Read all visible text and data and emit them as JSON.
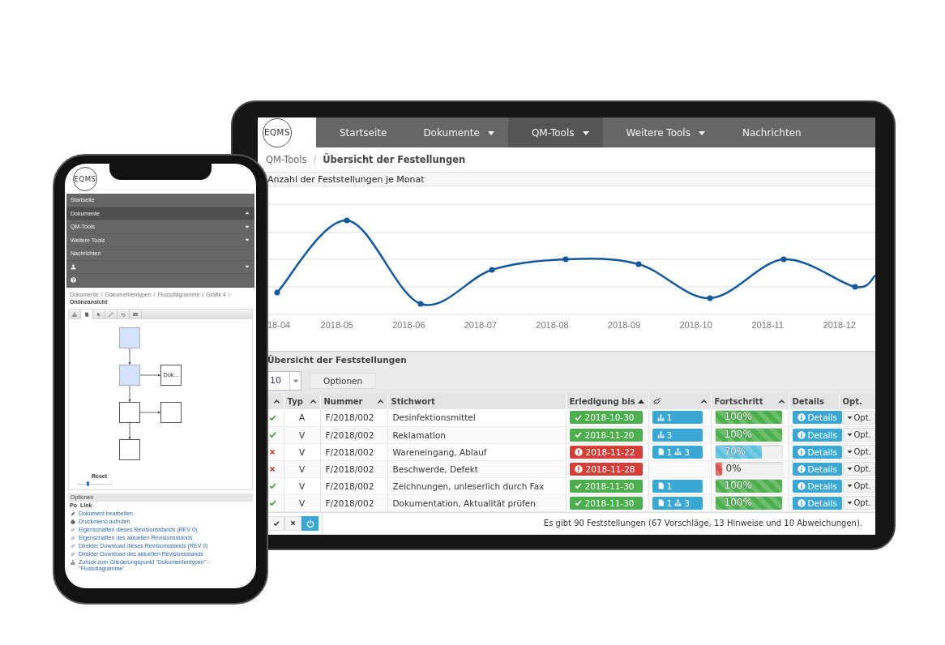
{
  "tablet": {
    "logo": "EQMS",
    "nav": [
      {
        "label": "Startseite",
        "dropdown": false,
        "selected": false
      },
      {
        "label": "Dokumente",
        "dropdown": true,
        "selected": false
      },
      {
        "label": "QM-Tools",
        "dropdown": true,
        "selected": true
      },
      {
        "label": "Weitere Tools",
        "dropdown": true,
        "selected": false
      },
      {
        "label": "Nachrichten",
        "dropdown": false,
        "selected": false
      }
    ],
    "breadcrumb": {
      "separator": "/",
      "items": [
        "QM-Tools",
        "Übersicht der Festellungen"
      ]
    },
    "chart": {
      "title": "Anzahl der Feststellungen je Monat",
      "x_labels": [
        "18-04",
        "2018-05",
        "2018-06",
        "2018-07",
        "2018-08",
        "2018-09",
        "2018-10",
        "2018-11",
        "2018-12"
      ]
    },
    "findings": {
      "title": "Übersicht der Feststellungen",
      "page_size": "10",
      "options_button": "Optionen",
      "columns": [
        {
          "kind": "blank",
          "sortable": true,
          "sorted": false
        },
        {
          "kind": "text",
          "label": "Typ",
          "sortable": true,
          "sorted": false
        },
        {
          "kind": "text",
          "label": "Nummer",
          "sortable": true,
          "sorted": false
        },
        {
          "kind": "text",
          "label": "Stichwort",
          "sortable": false
        },
        {
          "kind": "text",
          "label": "Erledigung bis",
          "sortable": true,
          "sorted": true
        },
        {
          "kind": "link",
          "sortable": true,
          "sorted": false
        },
        {
          "kind": "text",
          "label": "Fortschritt",
          "sortable": true,
          "sorted": false
        },
        {
          "kind": "text",
          "label": "Details",
          "sortable": false
        },
        {
          "kind": "text",
          "label": "Opt.",
          "sortable": false
        }
      ],
      "rows": [
        {
          "done": true,
          "typ": "A",
          "nummer": "F/2018/002",
          "stichwort": "Desinfektionsmittel",
          "due": {
            "overdue": false,
            "date": "2018-10-30"
          },
          "links": [
            {
              "kind": "tree",
              "count": "1"
            }
          ],
          "progress": {
            "level": 1,
            "text": "100%"
          },
          "details": "Details",
          "opt": "Opt."
        },
        {
          "done": true,
          "typ": "V",
          "nummer": "F/2018/002",
          "stichwort": "Reklamation",
          "due": {
            "overdue": false,
            "date": "2018-11-20"
          },
          "links": [
            {
              "kind": "tree",
              "count": "3"
            }
          ],
          "progress": {
            "level": 1,
            "text": "100%"
          },
          "details": "Details",
          "opt": "Opt."
        },
        {
          "done": false,
          "typ": "V",
          "nummer": "F/2018/002",
          "stichwort": "Wareneingang, Ablauf",
          "due": {
            "overdue": true,
            "date": "2018-11-22"
          },
          "links": [
            {
              "kind": "doc",
              "count": "1"
            },
            {
              "kind": "tree",
              "count": "3"
            }
          ],
          "progress": {
            "level": 0.7,
            "text": "70%"
          },
          "details": "Details",
          "opt": "Opt."
        },
        {
          "done": false,
          "typ": "V",
          "nummer": "F/2018/002",
          "stichwort": "Beschwerde, Defekt",
          "due": {
            "overdue": true,
            "date": "2018-11-28"
          },
          "progress": {
            "level": 0,
            "text": "0%"
          },
          "details": "Details",
          "opt": "Opt."
        },
        {
          "done": true,
          "typ": "V",
          "nummer": "F/2018/002",
          "stichwort": "Zeichnungen, unleserlich durch Fax",
          "due": {
            "overdue": false,
            "date": "2018-11-30"
          },
          "links": [
            {
              "kind": "doc",
              "count": "1"
            }
          ],
          "progress": {
            "level": 1,
            "text": "100%"
          },
          "details": "Details",
          "opt": "Opt."
        },
        {
          "done": true,
          "typ": "V",
          "nummer": "F/2018/002",
          "stichwort": "Dokumentation, Aktualität prüfen",
          "due": {
            "overdue": false,
            "date": "2018-11-30"
          },
          "links": [
            {
              "kind": "doc",
              "count": "1"
            },
            {
              "kind": "tree",
              "count": "3"
            }
          ],
          "progress": {
            "level": 1,
            "text": "100%"
          },
          "details": "Details",
          "opt": "Opt."
        }
      ],
      "footer_buttons": [
        {
          "kind": "check"
        },
        {
          "kind": "cross"
        },
        {
          "kind": "power"
        }
      ],
      "summary": "Es gibt 90 Feststellungen (67 Vorschläge, 13 Hinweise und 10 Abweichungen)."
    }
  },
  "phone": {
    "logo": "EQMS",
    "menu": [
      {
        "kind": "text",
        "label": "Startseite",
        "dropdown": false,
        "expanded": false
      },
      {
        "kind": "text",
        "label": "Dokumente",
        "dropdown": true,
        "expanded": true
      },
      {
        "kind": "text",
        "label": "QM-Tools",
        "dropdown": true,
        "expanded": false
      },
      {
        "kind": "text",
        "label": "Weitere Tools",
        "dropdown": true,
        "expanded": false
      },
      {
        "kind": "text",
        "label": "Nachrichten",
        "dropdown": false,
        "expanded": false
      },
      {
        "kind": "user",
        "dropdown": true,
        "expanded": false
      },
      {
        "kind": "help",
        "dropdown": false,
        "expanded": false
      }
    ],
    "breadcrumb": {
      "separator": "/",
      "items": [
        "Dokumente",
        "Dokumententypen",
        "Flussdiagramme",
        "Grafik 4",
        "Onlineansicht"
      ]
    },
    "tools": [
      {
        "kind": "tree",
        "selected": false
      },
      {
        "kind": "doc",
        "selected": true
      },
      {
        "kind": "pointer",
        "selected": false
      },
      {
        "kind": "line",
        "selected": false
      },
      {
        "kind": "undo",
        "selected": false
      },
      {
        "kind": "image",
        "selected": false
      }
    ],
    "diagram": {
      "nodes": [
        {
          "highlighted": true
        },
        {
          "highlighted": true
        },
        {
          "highlighted": false,
          "label": "Dok..."
        },
        {
          "highlighted": false
        },
        {
          "highlighted": false
        },
        {
          "highlighted": false
        }
      ]
    },
    "zoom": {
      "reset": "Reset",
      "level": 0.3
    },
    "options": {
      "title": "Optionen",
      "columns": [
        "Po",
        "Link"
      ],
      "links": [
        {
          "kind": "edit",
          "label": "Dokument bearbeiten"
        },
        {
          "kind": "print",
          "label": "Druckmenü aufrufen"
        },
        {
          "kind": "link",
          "label": "Eigenschaften dieses Revisionsstands (REV 0)"
        },
        {
          "kind": "link",
          "label": "Eigenschaften des aktuellen Revisionsstands"
        },
        {
          "kind": "link",
          "label": "Direkter Download dieses Revisionsstands (REV 0)"
        },
        {
          "kind": "link",
          "label": "Direkter Download des aktuellen Revisionsstands"
        },
        {
          "kind": "tree",
          "label": "Zurück zum Gliederungspunkt \"Dokumententypen\" - \"Flussdiagramme\""
        }
      ]
    }
  }
}
